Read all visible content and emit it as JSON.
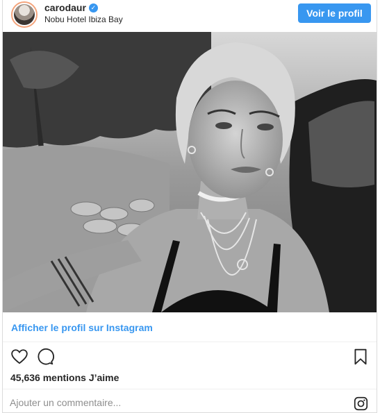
{
  "post": {
    "username": "carodaur",
    "verified_icon": "verified-badge-icon",
    "location": "Nobu Hotel Ibiza Bay",
    "view_profile_label": "Voir le profil"
  },
  "photo": {
    "icon": "photo",
    "colors": {
      "sky": "#e9e9e9",
      "trees": "#2e2e2e",
      "skin": "#b9b9b9",
      "hair": "#d9d9d9",
      "car": "#222222"
    }
  },
  "instagram_link": {
    "label": "Afficher le profil sur Instagram",
    "color": "#3897f0"
  },
  "actions": {
    "like_icon": "heart-icon",
    "comment_icon": "comment-bubble-icon",
    "save_icon": "bookmark-icon"
  },
  "likes": {
    "text": "45,636 mentions J’aime"
  },
  "comment": {
    "placeholder": "Ajouter un commentaire...",
    "logo_icon": "instagram-logo-icon"
  }
}
